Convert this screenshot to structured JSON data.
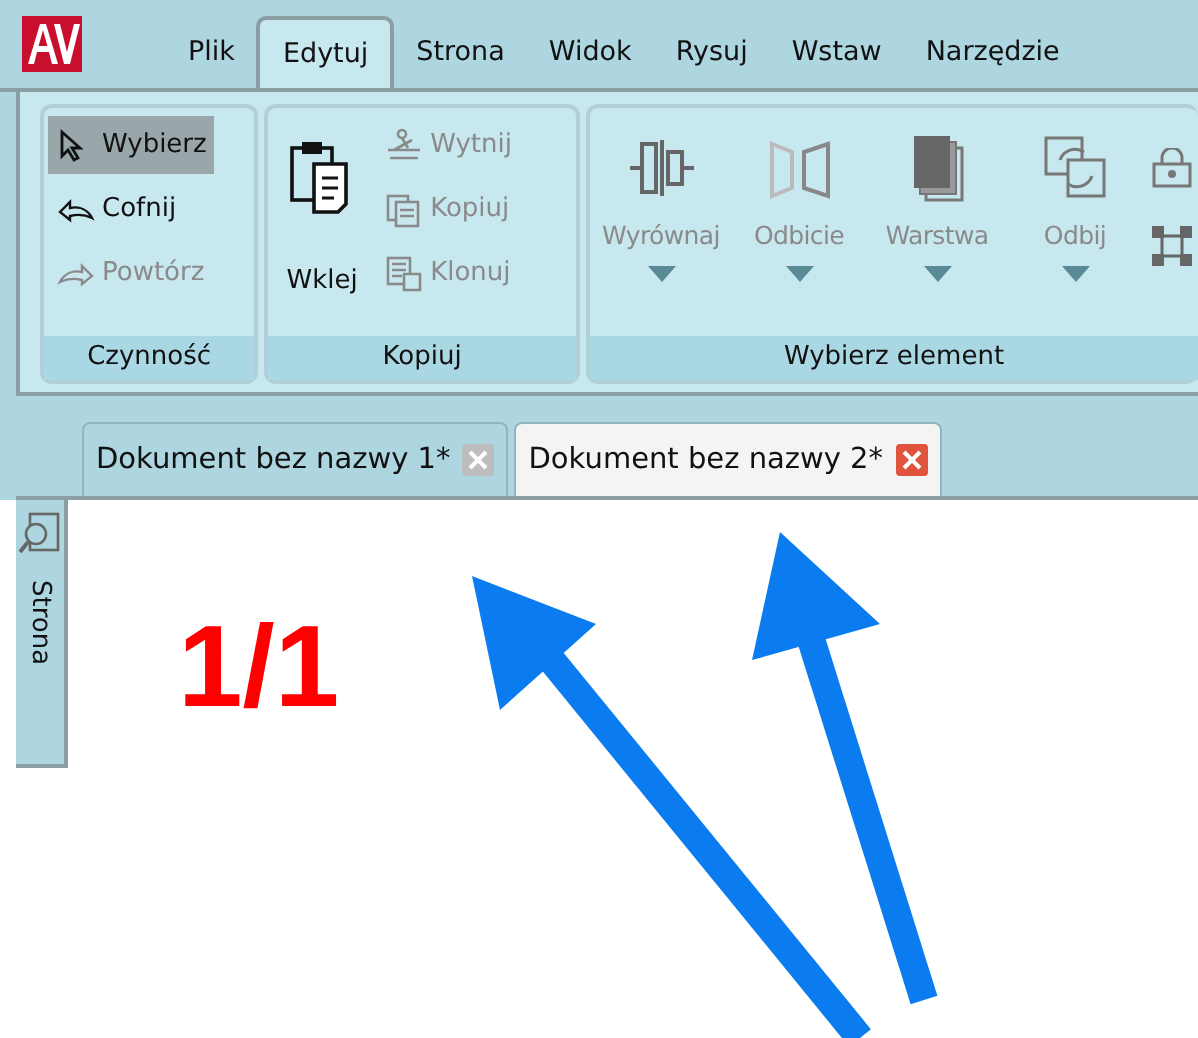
{
  "menu": [
    {
      "label": "Plik",
      "selected": false
    },
    {
      "label": "Edytuj",
      "selected": true
    },
    {
      "label": "Strona",
      "selected": false
    },
    {
      "label": "Widok",
      "selected": false
    },
    {
      "label": "Rysuj",
      "selected": false
    },
    {
      "label": "Wstaw",
      "selected": false
    },
    {
      "label": "Narzędzie",
      "selected": false
    }
  ],
  "ribbon": {
    "groups": [
      {
        "label": "Czynność",
        "items": [
          {
            "label": "Wybierz",
            "selected": true,
            "disabled": false
          },
          {
            "label": "Cofnij",
            "selected": false,
            "disabled": false
          },
          {
            "label": "Powtórz",
            "selected": false,
            "disabled": true
          }
        ]
      },
      {
        "label": "Kopiuj",
        "large": {
          "label": "Wklej",
          "disabled": false
        },
        "items": [
          {
            "label": "Wytnij",
            "selected": false,
            "disabled": true
          },
          {
            "label": "Kopiuj",
            "selected": false,
            "disabled": true
          },
          {
            "label": "Klonuj",
            "selected": false,
            "disabled": true
          }
        ]
      },
      {
        "label": "Wybierz element",
        "dropdowns": [
          {
            "label": "Wyrównaj",
            "disabled": true
          },
          {
            "label": "Odbicie",
            "disabled": true
          },
          {
            "label": "Warstwa",
            "disabled": true
          },
          {
            "label": "Odbij",
            "disabled": true
          }
        ]
      }
    ]
  },
  "documents": [
    {
      "title": "Dokument bez nazwy 1*",
      "selected": false
    },
    {
      "title": "Dokument bez nazwy 2*",
      "selected": true
    }
  ],
  "side_panel": {
    "label": "Strona"
  },
  "canvas": {
    "annotation": "1/1"
  }
}
